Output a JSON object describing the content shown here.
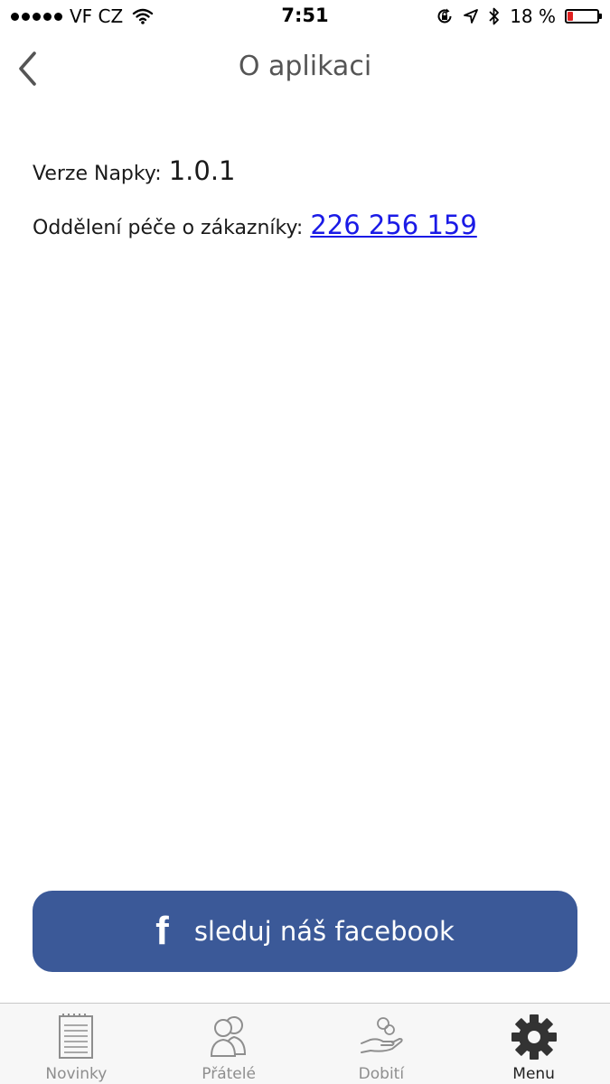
{
  "status_bar": {
    "carrier": "VF CZ",
    "time": "7:51",
    "battery_text": "18 %",
    "battery_level": 0.18
  },
  "nav": {
    "title": "O aplikaci"
  },
  "content": {
    "version_label": "Verze Napky:",
    "version_value": "1.0.1",
    "support_label": "Oddělení péče o zákazníky:",
    "support_phone": "226 256 159"
  },
  "facebook_button": {
    "icon": "f",
    "label": "sleduj náš facebook",
    "color": "#3b5998"
  },
  "tabs": [
    {
      "label": "Novinky",
      "icon": "news-icon",
      "active": false
    },
    {
      "label": "Přátelé",
      "icon": "friends-icon",
      "active": false
    },
    {
      "label": "Dobití",
      "icon": "top-up-icon",
      "active": false
    },
    {
      "label": "Menu",
      "icon": "gear-icon",
      "active": true
    }
  ]
}
